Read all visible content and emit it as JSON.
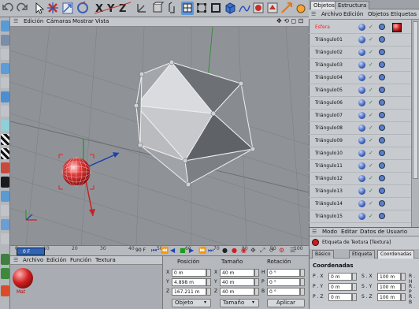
{
  "viewport_menu": {
    "edicion": "Edición",
    "camaras": "Cámaras",
    "mostrar": "Mostrar",
    "vista": "Vista"
  },
  "timeline": {
    "ticks": [
      "0",
      "10",
      "20",
      "30",
      "40",
      "50",
      "60",
      "70",
      "80",
      "90",
      "100"
    ],
    "end_label": "90 F",
    "frame_field": "0 F"
  },
  "materials_menu": {
    "archivo": "Archivo",
    "edicion": "Edición",
    "funcion": "Función",
    "textura": "Textura",
    "material_name": "Mat"
  },
  "coords": {
    "headers": {
      "posicion": "Posición",
      "tamano": "Tamaño",
      "rotacion": "Rotación"
    },
    "labels": {
      "x": "X",
      "y": "Y",
      "z": "Z",
      "h": "H",
      "p": "P",
      "b": "B"
    },
    "pos": [
      "0 m",
      "4.898 m",
      "167.211 m"
    ],
    "size": [
      "40 m",
      "40 m",
      "40 m"
    ],
    "rot": [
      "0 °",
      "0 °",
      "0 °"
    ],
    "mode_dropdown": "Objeto",
    "size_dropdown": "Tamaño",
    "apply": "Aplicar"
  },
  "object_manager": {
    "tabs": [
      "Objetos",
      "Estructura"
    ],
    "menu": {
      "archivo": "Archivo",
      "edicion": "Edición",
      "objetos": "Objetos",
      "etiquetas": "Etiquetas"
    },
    "objects": [
      "Esfera",
      "Triángulo01",
      "Triángulo02",
      "Triángulo03",
      "Triángulo04",
      "Triángulo05",
      "Triángulo06",
      "Triángulo07",
      "Triángulo08",
      "Triángulo09",
      "Triángulo10",
      "Triángulo11",
      "Triángulo12",
      "Triángulo13",
      "Triángulo14",
      "Triángulo15"
    ]
  },
  "attribute_manager": {
    "menu": {
      "modo": "Modo",
      "editar": "Editar",
      "datos": "Datos de Usuario"
    },
    "title": "Etiqueta de Textura [Textura]",
    "tabs": [
      "Básico",
      "Etiqueta",
      "Coordenadas"
    ],
    "section": "Coordenadas",
    "labels": {
      "px": "P . X",
      "py": "P . Y",
      "pz": "P . Z",
      "sx": "S . X",
      "sy": "S . Y",
      "sz": "S . Z",
      "rh": "R . H",
      "rp": "R . P",
      "rb": "R . B"
    },
    "p_values": [
      "0 m",
      "0 m",
      "0 m"
    ],
    "s_values": [
      "100 m",
      "100 m",
      "100 m"
    ]
  },
  "colors": {
    "selected_object": "#ff2020",
    "frame_field": "#2f63b5",
    "sphere": "#cf1f1f"
  }
}
